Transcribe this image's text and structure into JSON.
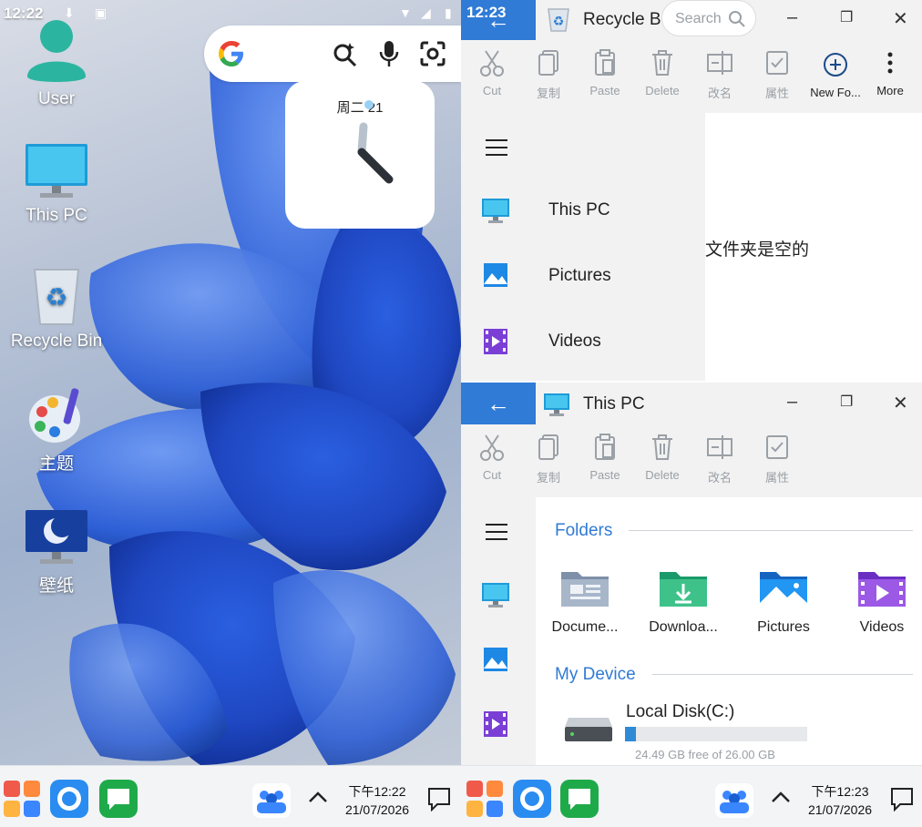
{
  "left": {
    "status_time": "12:22",
    "desktop_icons": [
      {
        "label": "User"
      },
      {
        "label": "This PC"
      },
      {
        "label": "Recycle Bin"
      },
      {
        "label": "主题"
      },
      {
        "label": "壁纸"
      }
    ],
    "clock_widget_date": "周二 21",
    "taskbar_time": "下午12:22",
    "taskbar_date": "21/07/2026"
  },
  "right": {
    "status_time": "12:23",
    "recycle_window": {
      "title": "Recycle B",
      "search_placeholder": "Search",
      "empty_message": "文件夹是空的",
      "nav": [
        {
          "label": "This PC"
        },
        {
          "label": "Pictures"
        },
        {
          "label": "Videos"
        }
      ]
    },
    "toolbar": {
      "cut": "Cut",
      "copy": "复制",
      "paste": "Paste",
      "delete": "Delete",
      "rename": "改名",
      "properties": "属性",
      "new_folder": "New Fo...",
      "more": "More"
    },
    "thispc_window": {
      "title": "This PC",
      "folders_heading": "Folders",
      "folders": [
        {
          "label": "Docume..."
        },
        {
          "label": "Downloa..."
        },
        {
          "label": "Pictures"
        },
        {
          "label": "Videos"
        }
      ],
      "device_heading": "My Device",
      "disk_name": "Local Disk(C:)",
      "disk_free": "24.49 GB free of 26.00 GB",
      "disk_used_fraction": 0.058
    },
    "taskbar_time": "下午12:23",
    "taskbar_date": "21/07/2026"
  },
  "colors": {
    "accent": "#2f7bd6",
    "taskbar": "#f3f4f6"
  }
}
